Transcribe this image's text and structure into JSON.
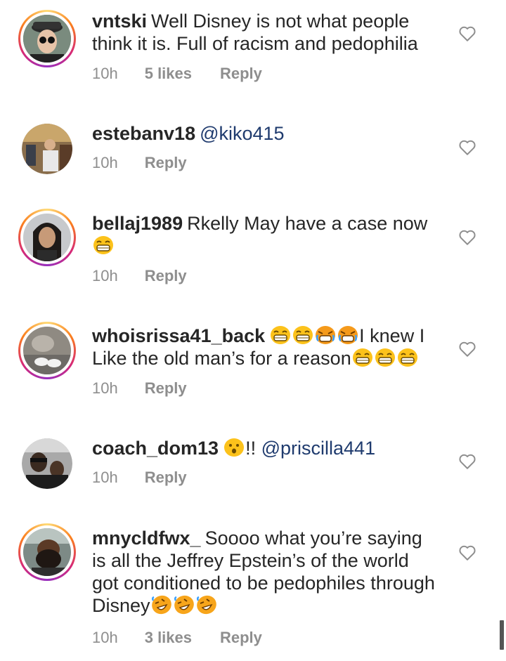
{
  "comments": [
    {
      "user": "vntski",
      "text": "Well Disney is not what people think it is. Full of racism and pedophilia",
      "mention": "",
      "emojis_mid": [],
      "text2": "",
      "emojis_end": [],
      "time": "10h",
      "likes": "5 likes",
      "reply": "Reply"
    },
    {
      "user": "estebanv18",
      "text": "",
      "mention": "@kiko415",
      "emojis_mid": [],
      "text2": "",
      "emojis_end": [],
      "time": "10h",
      "likes": "",
      "reply": "Reply"
    },
    {
      "user": "bellaj1989",
      "text": "Rkelly May have a case now",
      "mention": "",
      "emojis_mid": [],
      "text2": "",
      "emojis_end": [
        "grin"
      ],
      "time": "10h",
      "likes": "",
      "reply": "Reply"
    },
    {
      "user": "whoisrissa41_back",
      "text": "",
      "mention": "",
      "emojis_mid": [
        "grin",
        "grin",
        "cry",
        "cry"
      ],
      "text2": "I knew I Like the old man’s for a reason",
      "emojis_end": [
        "grin",
        "grin",
        "grin"
      ],
      "time": "10h",
      "likes": "",
      "reply": "Reply"
    },
    {
      "user": "coach_dom13",
      "text": "",
      "mention": "@priscilla441",
      "emojis_mid": [
        "hushed"
      ],
      "text2": "!!",
      "emojis_end": [],
      "time": "10h",
      "likes": "",
      "reply": "Reply"
    },
    {
      "user": "mnycldfwx_",
      "text": "Soooo what you’re saying is all the Jeffrey Epstein’s of the world got conditioned to be pedophiles through Disney",
      "mention": "",
      "emojis_mid": [],
      "text2": "",
      "emojis_end": [
        "rofl",
        "rofl",
        "rofl"
      ],
      "time": "10h",
      "likes": "3 likes",
      "reply": "Reply"
    }
  ],
  "icons": {
    "like": "heart-outline-icon"
  }
}
